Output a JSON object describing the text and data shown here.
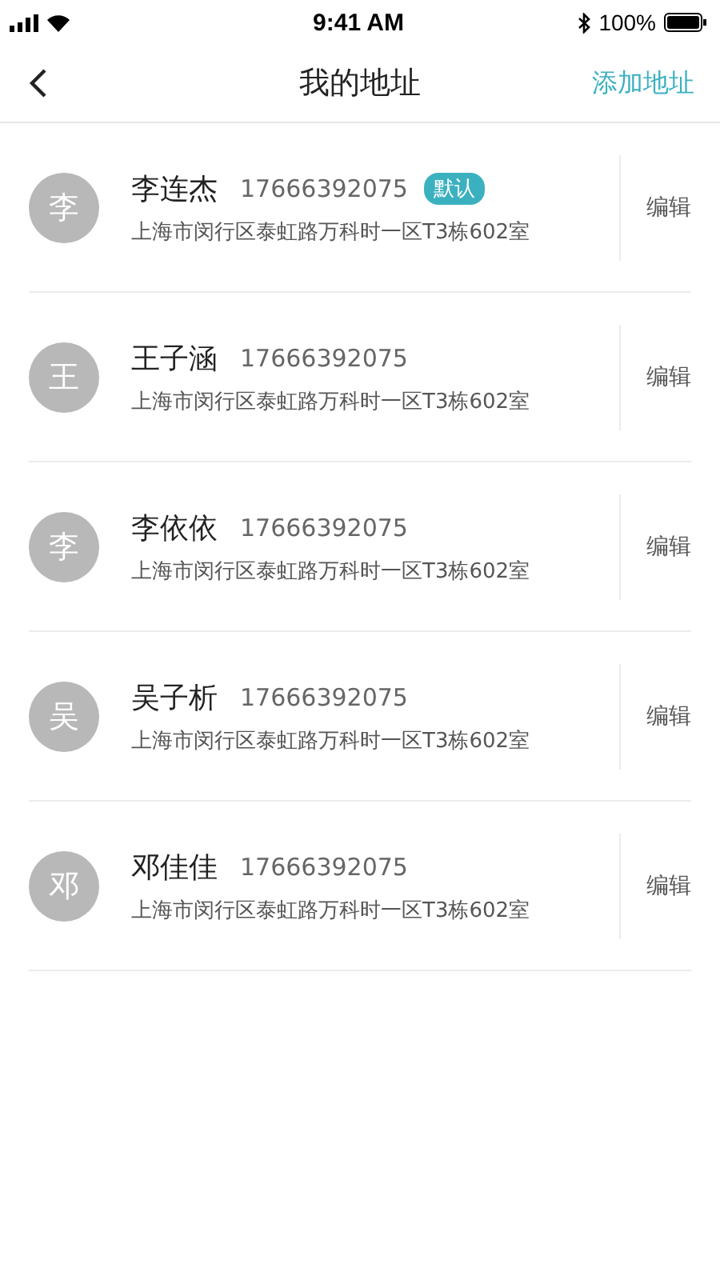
{
  "status_bar": {
    "time": "9:41 AM",
    "battery": "100%"
  },
  "nav": {
    "title": "我的地址",
    "action": "添加地址"
  },
  "default_badge": "默认",
  "addresses": [
    {
      "avatar": "李",
      "name": "李连杰",
      "phone": "17666392075",
      "is_default": true,
      "address": "上海市闵行区泰虹路万科时一区T3栋602室",
      "edit": "编辑"
    },
    {
      "avatar": "王",
      "name": "王子涵",
      "phone": "17666392075",
      "is_default": false,
      "address": "上海市闵行区泰虹路万科时一区T3栋602室",
      "edit": "编辑"
    },
    {
      "avatar": "李",
      "name": "李依依",
      "phone": "17666392075",
      "is_default": false,
      "address": "上海市闵行区泰虹路万科时一区T3栋602室",
      "edit": "编辑"
    },
    {
      "avatar": "吴",
      "name": "吴子析",
      "phone": "17666392075",
      "is_default": false,
      "address": "上海市闵行区泰虹路万科时一区T3栋602室",
      "edit": "编辑"
    },
    {
      "avatar": "邓",
      "name": "邓佳佳",
      "phone": "17666392075",
      "is_default": false,
      "address": "上海市闵行区泰虹路万科时一区T3栋602室",
      "edit": "编辑"
    }
  ]
}
